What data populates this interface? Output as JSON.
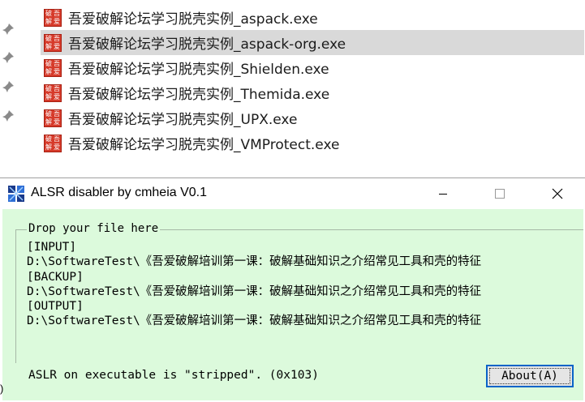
{
  "explorer": {
    "files": [
      {
        "name": "吾爱破解论坛学习脱壳实例_aspack.exe",
        "selected": false
      },
      {
        "name": "吾爱破解论坛学习脱壳实例_aspack-org.exe",
        "selected": true
      },
      {
        "name": "吾爱破解论坛学习脱壳实例_Shielden.exe",
        "selected": false
      },
      {
        "name": "吾爱破解论坛学习脱壳实例_Themida.exe",
        "selected": false
      },
      {
        "name": "吾爱破解论坛学习脱壳实例_UPX.exe",
        "selected": false
      },
      {
        "name": "吾爱破解论坛学习脱壳实例_VMProtect.exe",
        "selected": false
      }
    ],
    "file_icon_glyphs": [
      "破",
      "吾",
      "解",
      "爱"
    ],
    "pin_icon": "pin-icon"
  },
  "window": {
    "title": "ALSR disabler by cmheia V0.1",
    "group_title": "Drop your file here",
    "log": {
      "input_label": "[INPUT]",
      "input_path": "D:\\SoftwareTest\\《吾爱破解培训第一课：破解基础知识之介绍常见工具和壳的特征",
      "backup_label": "[BACKUP]",
      "backup_path": "D:\\SoftwareTest\\《吾爱破解培训第一课：破解基础知识之介绍常见工具和壳的特征",
      "output_label": "[OUTPUT]",
      "output_path": "D:\\SoftwareTest\\《吾爱破解培训第一课：破解基础知识之介绍常见工具和壳的特征"
    },
    "status_text": "ASLR on executable is \"stripped\". (0x103)",
    "about_button": "About(A)",
    "colors": {
      "client_bg": "#dcfadc",
      "button_border": "#0a64c8",
      "selection": "#d9d9d9"
    }
  },
  "left_fragment": ")"
}
